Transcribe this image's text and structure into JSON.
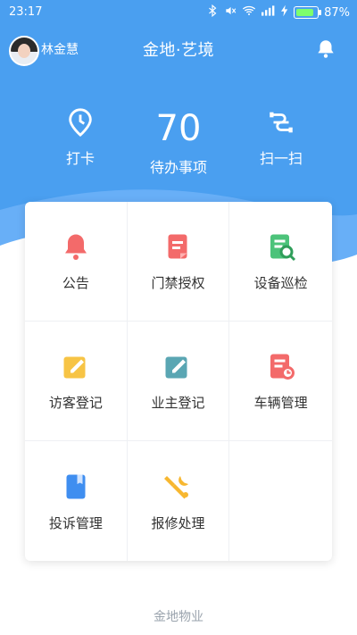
{
  "status": {
    "time": "23:17",
    "battery_percent": "87%",
    "battery_level": 0.87
  },
  "user": {
    "name": "林金慧"
  },
  "header": {
    "title": "金地·艺境"
  },
  "quick": {
    "clock_label": "打卡",
    "todo_count": "70",
    "todo_label": "待办事项",
    "scan_label": "扫一扫"
  },
  "menu": [
    {
      "label": "公告",
      "icon": "bell-icon",
      "color": "#f36a6a"
    },
    {
      "label": "门禁授权",
      "icon": "document-icon",
      "color": "#f36a6a"
    },
    {
      "label": "设备巡检",
      "icon": "inspect-icon",
      "color": "#4cc37a"
    },
    {
      "label": "访客登记",
      "icon": "edit-icon",
      "color": "#f7c445"
    },
    {
      "label": "业主登记",
      "icon": "edit-icon",
      "color": "#5aa6b3"
    },
    {
      "label": "车辆管理",
      "icon": "list-clock-icon",
      "color": "#f36a6a"
    },
    {
      "label": "投诉管理",
      "icon": "bookmark-icon",
      "color": "#3f8ef0"
    },
    {
      "label": "报修处理",
      "icon": "wrench-icon",
      "color": "#f7b730"
    },
    {
      "label": "",
      "icon": "",
      "color": ""
    }
  ],
  "footer": {
    "brand": "金地物业"
  }
}
